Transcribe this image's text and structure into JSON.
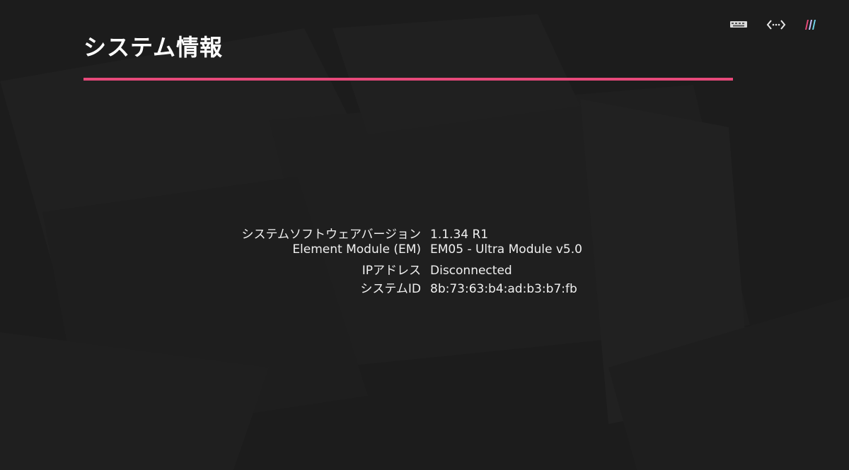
{
  "header": {
    "title": "システム情報"
  },
  "toolbar": {
    "icons": [
      "keyboard-icon",
      "network-code-icon",
      "brand-stripes-icon"
    ]
  },
  "system_info": {
    "rows": [
      {
        "label": "システムソフトウェアバージョン",
        "value": "1.1.34 R1"
      },
      {
        "label": "Element Module (EM)",
        "value": "EM05 - Ultra Module v5.0"
      },
      {
        "label": "IPアドレス",
        "value": "Disconnected"
      },
      {
        "label": "システムID",
        "value": "8b:73:63:b4:ad:b3:b7:fb"
      }
    ]
  },
  "colors": {
    "accent": "#e6497a",
    "background": "#1c1c1c",
    "text": "#f0f0f0"
  }
}
